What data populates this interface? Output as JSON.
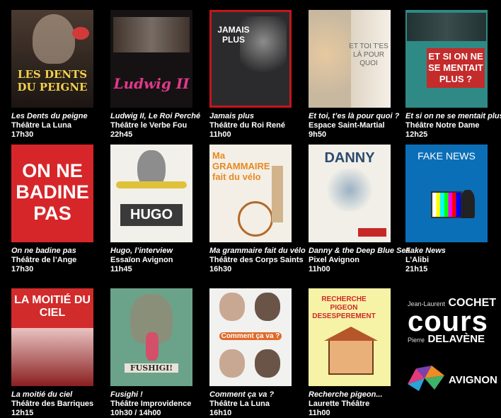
{
  "shows": [
    {
      "title": "Les Dents du peigne",
      "venue": "Théâtre La Luna",
      "time": "17h30",
      "poster_text": "LES DENTS DU PEIGNE",
      "color": "#3a2e28"
    },
    {
      "title": "Ludwig II, Le Roi Perché",
      "venue": "Théâtre le Verbe Fou",
      "time": "22h45",
      "poster_text": "Ludwig II",
      "color": "#1a1416"
    },
    {
      "title": "Jamais plus",
      "venue": "Théâtre du Roi René",
      "time": "11h00",
      "poster_text": "JAMAIS PLUS",
      "color": "#2b2b2d"
    },
    {
      "title": "Et toi, t’es là pour quoi ?",
      "venue": "Espace Saint-Martial",
      "time": "9h50",
      "poster_text": "ET TOI T'ES LÀ POUR QUOI",
      "color": "#e9e2d6"
    },
    {
      "title": "Et si on ne se mentait plus?",
      "venue": "Théâtre Notre Dame",
      "time": "12h25",
      "poster_text": "ET SI ON NE SE MENTAIT PLUS ?",
      "color": "#2f8a86"
    },
    {
      "title": "On ne badine pas",
      "venue": "Théâtre de l’Ange",
      "time": "17h30",
      "poster_text": "ON NE BADINE PAS",
      "color": "#d7262a"
    },
    {
      "title": "Hugo, l’interview",
      "venue": "Essaïon Avignon",
      "time": "11h45",
      "poster_text": "HUGO",
      "color": "#f2f0ea"
    },
    {
      "title": "Ma grammaire fait du vélo",
      "venue": "Théâtre des Corps Saints",
      "time": "16h30",
      "poster_text": "Ma GRAMMAIRE fait du vélo",
      "color": "#f3efe6"
    },
    {
      "title": "Danny & the Deep Blue Sea",
      "venue": "Pixel Avignon",
      "time": "11h00",
      "poster_text": "DANNY",
      "color": "#f1efe8"
    },
    {
      "title": "Fake News",
      "venue": "L’Alibi",
      "time": "21h15",
      "poster_text": "FAKE NEWS",
      "color": "#0b6fb8"
    },
    {
      "title": "La moitié du ciel",
      "venue": "Théâtre des Barriques",
      "time": "12h15",
      "poster_text": "LA MOITIÉ DU CIEL",
      "color": "#d22b2b"
    },
    {
      "title": "Fusighi !",
      "venue": "Théâtre Improvidence",
      "time": "10h30 / 14h00",
      "poster_text": "FUSHIGI!",
      "color": "#6aa38a"
    },
    {
      "title": "Comment ça va ?",
      "venue": "Théâtre La Luna",
      "time": "16h10",
      "poster_text": "Comment ça va ?",
      "color": "#f1f1ef"
    },
    {
      "title": "Recherche pigeon...",
      "venue": "Laurette Théâtre",
      "time": "11h00",
      "poster_text": "RECHERCHE PIGEON DESESPEREMENT",
      "color": "#f6f2a6"
    }
  ],
  "brand": {
    "name_first_top": "Jean-Laurent",
    "name_last_top": "COCHET",
    "middle": "cours",
    "name_first_bottom": "Pierre",
    "name_last_bottom": "DELAVÈNE",
    "city": "AVIGNON"
  }
}
